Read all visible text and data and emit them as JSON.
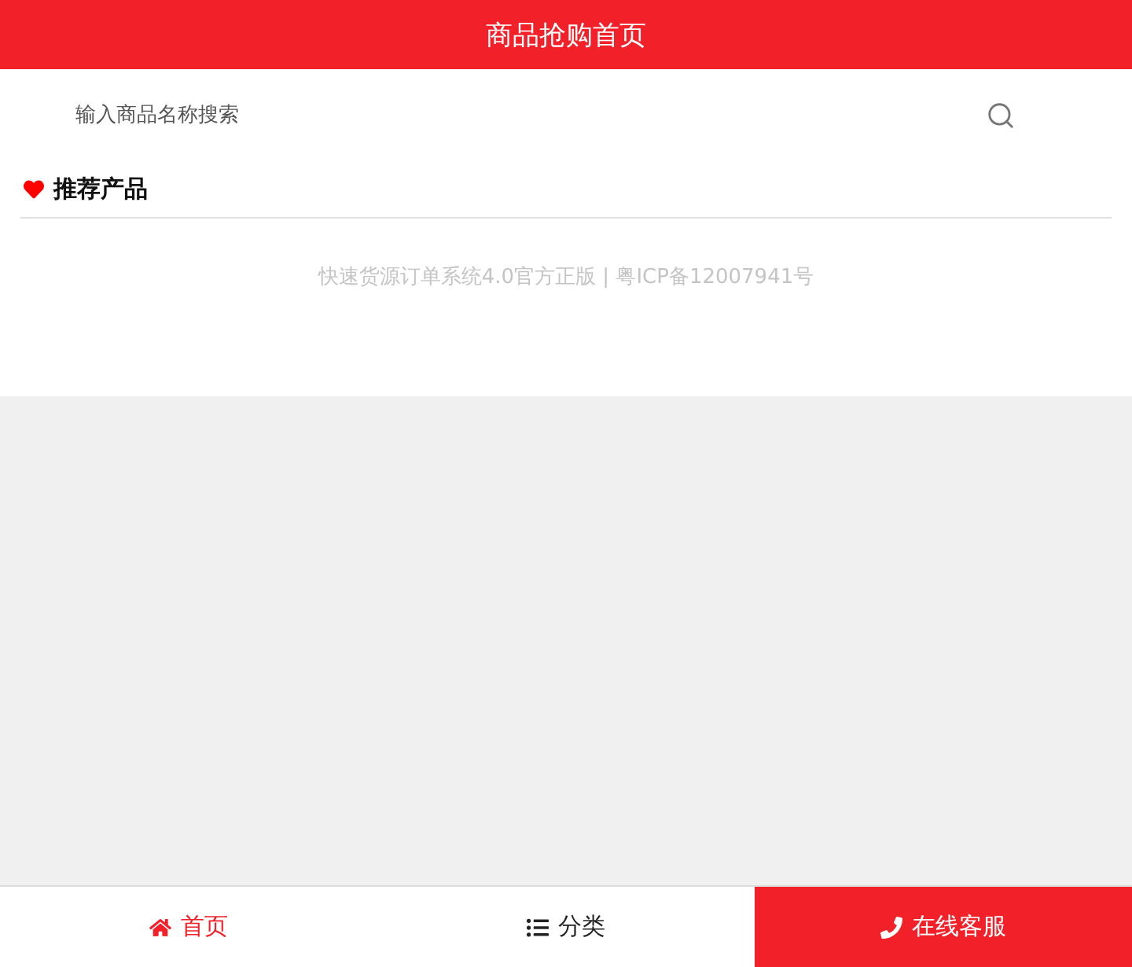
{
  "header": {
    "title": "商品抢购首页"
  },
  "search": {
    "placeholder": "输入商品名称搜索"
  },
  "section": {
    "title": "推荐产品"
  },
  "footer_note": "快速货源订单系统4.0官方正版 | 粤ICP备12007941号",
  "nav": [
    {
      "kind": "home",
      "label": "首页",
      "selected": true
    },
    {
      "kind": "list",
      "label": "分类",
      "selected": false
    },
    {
      "kind": "phone",
      "label": "在线客服",
      "selected": false,
      "highlight": true
    }
  ]
}
